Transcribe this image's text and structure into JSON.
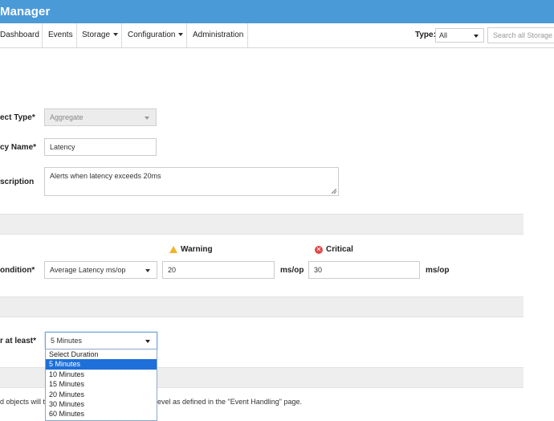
{
  "app": {
    "title": "Manager"
  },
  "nav": {
    "items": [
      {
        "label": "Dashboard",
        "has_caret": false
      },
      {
        "label": "Events",
        "has_caret": false
      },
      {
        "label": "Storage",
        "has_caret": true
      },
      {
        "label": "Configuration",
        "has_caret": true
      },
      {
        "label": "Administration",
        "has_caret": false
      }
    ],
    "type_label": "Type:",
    "type_value": "All",
    "search_placeholder": "Search all Storage"
  },
  "form": {
    "object_type_label": "ect Type*",
    "object_type_value": "Aggregate",
    "name_label": "cy Name*",
    "name_value": "Latency",
    "description_label": "scription",
    "description_value": "Alerts when latency exceeds 20ms",
    "condition_label": "ondition*",
    "condition_value": "Average Latency ms/op",
    "warning_label": "Warning",
    "critical_label": "Critical",
    "critical_icon_glyph": "✕",
    "warning_value": "20",
    "critical_value": "30",
    "unit": "ms/op",
    "duration_label": "r at least*",
    "duration_value": "5 Minutes",
    "duration_options": [
      {
        "label": "Select Duration",
        "selected": false
      },
      {
        "label": "5 Minutes",
        "selected": true
      },
      {
        "label": "10 Minutes",
        "selected": false
      },
      {
        "label": "15 Minutes",
        "selected": false
      },
      {
        "label": "20 Minutes",
        "selected": false
      },
      {
        "label": "30 Minutes",
        "selected": false
      },
      {
        "label": "60 Minutes",
        "selected": false
      }
    ],
    "footnote_left": "d objects will t",
    "footnote_right": "evel as defined in the \"Event Handling\" page."
  },
  "colors": {
    "header": "#4a9ad8",
    "section_band": "#eeeeee",
    "selected_option": "#1e6fd9",
    "warning": "#f0b429",
    "critical": "#e04848"
  },
  "icons": {
    "warning": "warning-triangle-icon",
    "critical": "critical-x-circle-icon",
    "dropdown": "chevron-down-icon"
  }
}
